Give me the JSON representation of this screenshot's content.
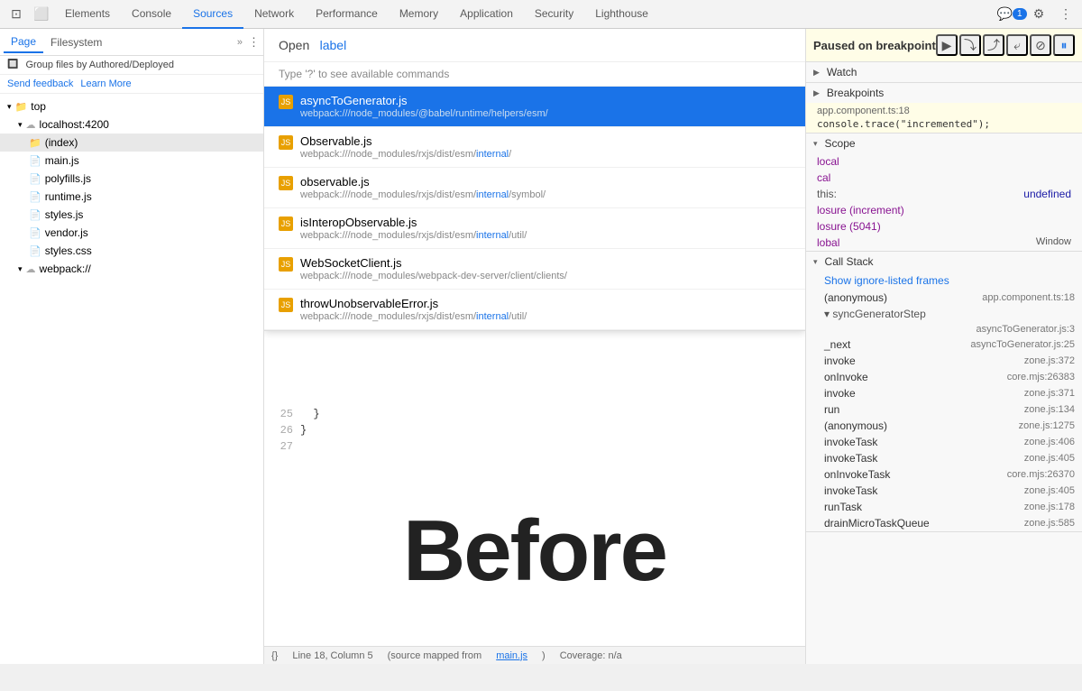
{
  "toolbar": {
    "tabs": [
      "Elements",
      "Console",
      "Sources",
      "Network",
      "Performance",
      "Memory",
      "Application",
      "Security",
      "Lighthouse"
    ],
    "active_tab": "Sources",
    "icons": {
      "dock": "⊡",
      "more": "⋮",
      "settings": "⚙",
      "chat_badge": "1"
    }
  },
  "left_panel": {
    "tabs": [
      "Page",
      "Filesystem"
    ],
    "active_tab": "Page",
    "options_icon": "≡",
    "send_feedback": "Send feedback",
    "learn_more": "Learn More",
    "group_files": "Group files by Authored/Deployed",
    "tree": [
      {
        "type": "folder",
        "label": "top",
        "indent": 0,
        "expanded": true
      },
      {
        "type": "cloud-folder",
        "label": "localhost:4200",
        "indent": 1,
        "expanded": true
      },
      {
        "type": "folder",
        "label": "(index)",
        "indent": 2,
        "selected": true
      },
      {
        "type": "js",
        "label": "main.js",
        "indent": 2
      },
      {
        "type": "js",
        "label": "polyfills.js",
        "indent": 2
      },
      {
        "type": "js",
        "label": "runtime.js",
        "indent": 2
      },
      {
        "type": "js",
        "label": "styles.js",
        "indent": 2
      },
      {
        "type": "js",
        "label": "vendor.js",
        "indent": 2
      },
      {
        "type": "css",
        "label": "styles.css",
        "indent": 2
      },
      {
        "type": "cloud-folder",
        "label": "webpack://",
        "indent": 1
      }
    ]
  },
  "open_file_dialog": {
    "label": "Open",
    "input_value": "label",
    "hint": "Type '?' to see available commands",
    "results": [
      {
        "name": "asyncToGenerator.js",
        "path": "webpack:///node_modules/@babel/runtime/helpers/esm/",
        "path_highlight_start": 39,
        "highlighted": true
      },
      {
        "name": "Observable.js",
        "path": "webpack:///node_modules/rxjs/dist/esm/internal/",
        "path_highlight": "internal"
      },
      {
        "name": "observable.js",
        "path": "webpack:///node_modules/rxjs/dist/esm/internal/symbol/",
        "path_highlight": "internal"
      },
      {
        "name": "isInteropObservable.js",
        "path": "webpack:///node_modules/rxjs/dist/esm/internal/util/",
        "path_highlight": "internal"
      },
      {
        "name": "WebSocketClient.js",
        "path": "webpack:///node_modules/webpack-dev-server/client/clients/"
      },
      {
        "name": "throwUnobservableError.js",
        "path": "webpack:///node_modules/rxjs/dist/esm/internal/util/",
        "path_highlight": "internal"
      }
    ]
  },
  "code": {
    "lines": [
      {
        "num": 25,
        "content": "  }"
      },
      {
        "num": 26,
        "content": "}"
      },
      {
        "num": 27,
        "content": ""
      }
    ],
    "big_text": "Before"
  },
  "status_bar": {
    "bracket_icon": "{}",
    "position": "Line 18, Column 5",
    "source_mapped": "(source mapped from",
    "source_file": "main.js",
    "coverage": "Coverage: n/a"
  },
  "right_panel": {
    "paused_label": "Paused on breakpoint",
    "debugger_buttons": [
      "▶",
      "⤵",
      "⤴",
      "⤶",
      "⊘",
      "⏸"
    ],
    "sections": {
      "watch": {
        "label": "Watch"
      },
      "breakpoints": {
        "label": "Breakpoints",
        "items": [
          {
            "file": "app.component.ts:18",
            "code": "console.trace(\"incremented\");"
          }
        ]
      },
      "scope": {
        "label": "Scope",
        "items": [
          {
            "key": "local",
            "val": ""
          },
          {
            "key": "cal",
            "val": ""
          },
          {
            "key": "this:",
            "val": "undefined"
          },
          {
            "key": "losure (increment)",
            "val": ""
          },
          {
            "key": "losure (5041)",
            "val": ""
          },
          {
            "key": "lobal",
            "val": "Window"
          }
        ]
      },
      "call_stack": {
        "label": "Call Stack",
        "show_ignore": "Show ignore-listed frames",
        "items": [
          {
            "fn": "(anonymous)",
            "loc": "app.component.ts:18"
          },
          {
            "fn": "▾ syncGeneratorStep",
            "loc": ""
          },
          {
            "fn": "",
            "loc": "asyncToGenerator.js:3"
          },
          {
            "fn": "_next",
            "loc": "asyncToGenerator.js:25"
          },
          {
            "fn": "invoke",
            "loc": "zone.js:372"
          },
          {
            "fn": "onInvoke",
            "loc": "core.mjs:26383"
          },
          {
            "fn": "invoke",
            "loc": "zone.js:371"
          },
          {
            "fn": "run",
            "loc": "zone.js:134"
          },
          {
            "fn": "(anonymous)",
            "loc": "zone.js:1275"
          },
          {
            "fn": "invokeTask",
            "loc": "zone.js:406"
          },
          {
            "fn": "invokeTask",
            "loc": "zone.js:405"
          },
          {
            "fn": "onInvokeTask",
            "loc": "core.mjs:26370"
          },
          {
            "fn": "invokeTask",
            "loc": "zone.js:405"
          },
          {
            "fn": "runTask",
            "loc": "zone.js:178"
          },
          {
            "fn": "drainMicroTaskQueue",
            "loc": "zone.js:585"
          }
        ]
      }
    }
  }
}
